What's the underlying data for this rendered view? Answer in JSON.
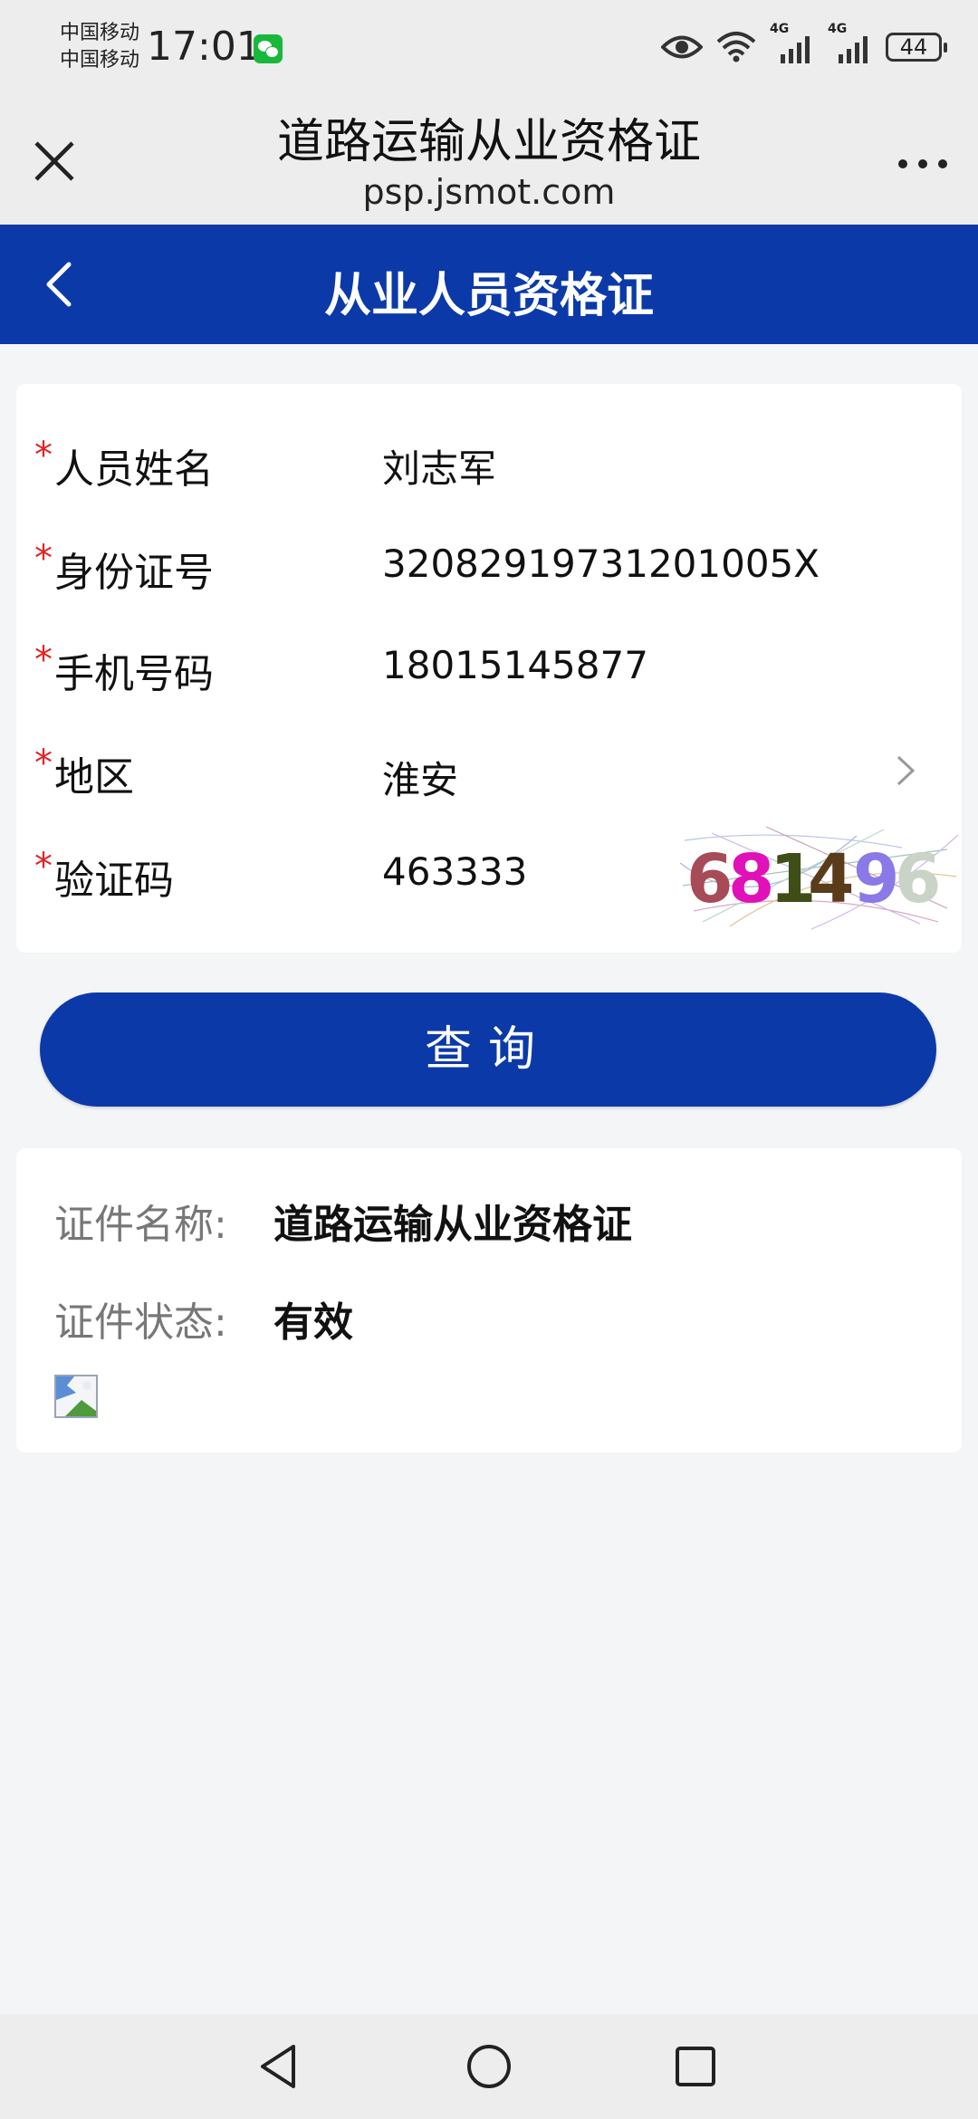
{
  "status_bar": {
    "carriers": [
      "中国移动",
      "中国移动"
    ],
    "time": "17:01",
    "network_labels": [
      "4G",
      "4G"
    ],
    "battery": "44"
  },
  "title_bar": {
    "title": "道路运输从业资格证",
    "domain": "psp.jsmot.com"
  },
  "header": {
    "title": "从业人员资格证"
  },
  "form": {
    "fields": [
      {
        "required": "*",
        "label": "人员姓名",
        "value": "刘志军"
      },
      {
        "required": "*",
        "label": "身份证号",
        "value": "32082919731201005X"
      },
      {
        "required": "*",
        "label": "手机号码",
        "value": "18015145877"
      },
      {
        "required": "*",
        "label": "地区",
        "value": "淮安"
      },
      {
        "required": "*",
        "label": "验证码",
        "value": "463333"
      }
    ],
    "captcha_text": "681496"
  },
  "query_button": "查询",
  "result": {
    "name_label": "证件名称:",
    "name_value": "道路运输从业资格证",
    "status_label": "证件状态:",
    "status_value": "有效"
  },
  "colors": {
    "brand_blue": "#0b3aa8",
    "required_red": "#e02424",
    "captcha_digits": [
      "#a64b57",
      "#e011b8",
      "#3f4d17",
      "#5a3c1a",
      "#8a79e6",
      "#c9d3c6"
    ]
  },
  "icons": [
    "eye-icon",
    "wifi-icon",
    "signal-icon",
    "battery-icon",
    "wechat-icon",
    "close-icon",
    "more-icon",
    "back-icon",
    "chevron-right-icon",
    "broken-image-icon",
    "nav-back-icon",
    "nav-home-icon",
    "nav-recents-icon"
  ]
}
